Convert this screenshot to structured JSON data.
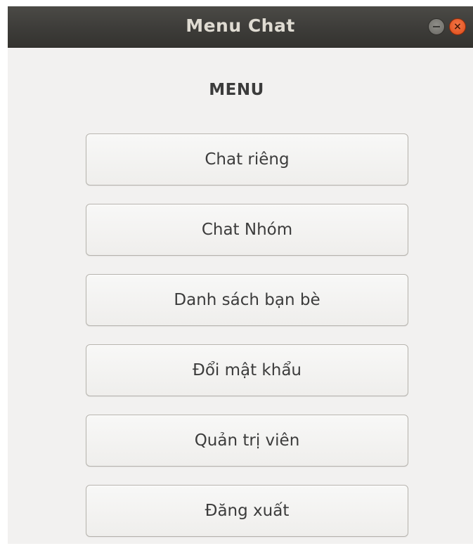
{
  "window": {
    "title": "Menu Chat",
    "minimize_icon": "minimize-icon",
    "close_icon": "close-icon",
    "close_glyph": "×"
  },
  "menu": {
    "heading": "MENU",
    "buttons": [
      {
        "label": "Chat riêng"
      },
      {
        "label": "Chat Nhóm"
      },
      {
        "label": "Danh sách bạn bè"
      },
      {
        "label": "Đổi mật khẩu"
      },
      {
        "label": "Quản trị  viên"
      },
      {
        "label": "Đăng xuất"
      }
    ]
  },
  "colors": {
    "titlebar": "#3d3c39",
    "close_button": "#e95420",
    "background": "#f2f1f0"
  }
}
